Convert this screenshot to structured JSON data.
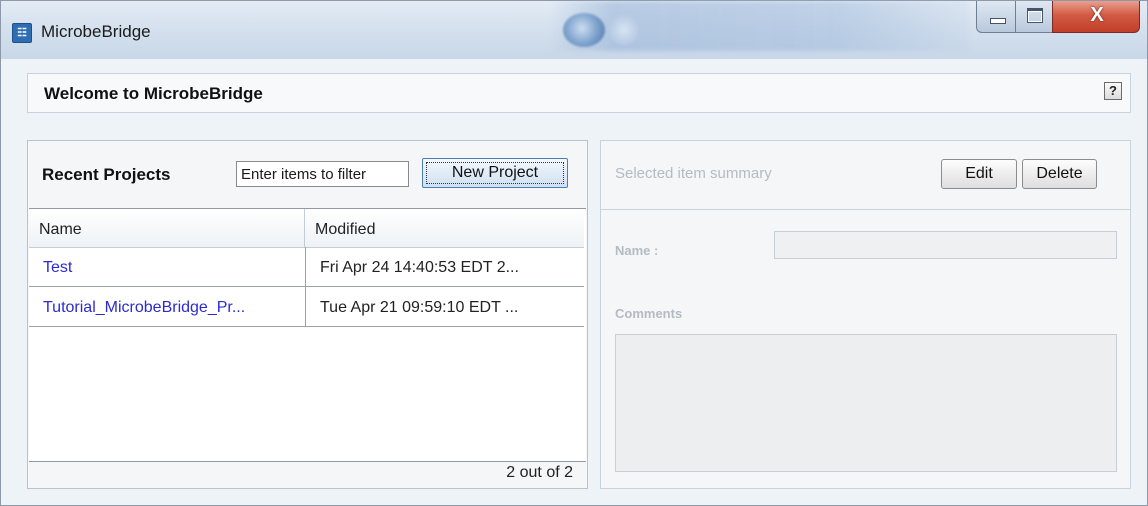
{
  "window": {
    "title": "MicrobeBridge",
    "close_glyph": "X",
    "icons": {
      "app": "app-icon",
      "minimize": "minimize-icon",
      "maximize": "maximize-icon",
      "close": "close-icon"
    }
  },
  "welcome": {
    "title": "Welcome to MicrobeBridge",
    "help_label": "?"
  },
  "recent_projects": {
    "title": "Recent Projects",
    "filter_placeholder": "Enter items to filter",
    "new_project_label": "New Project",
    "columns": [
      "Name",
      "Modified"
    ],
    "rows": [
      {
        "name": "Test",
        "modified": "Fri Apr 24 14:40:53 EDT 2..."
      },
      {
        "name": "Tutorial_MicrobeBridge_Pr...",
        "modified": "Tue Apr 21 09:59:10 EDT ..."
      }
    ],
    "count_text": "2 out of 2",
    "link_color": "#2b2bd0"
  },
  "summary": {
    "title": "Selected item summary",
    "edit_label": "Edit",
    "delete_label": "Delete",
    "name_label": "Name :",
    "name_value": "",
    "comments_label": "Comments",
    "comments_value": ""
  }
}
